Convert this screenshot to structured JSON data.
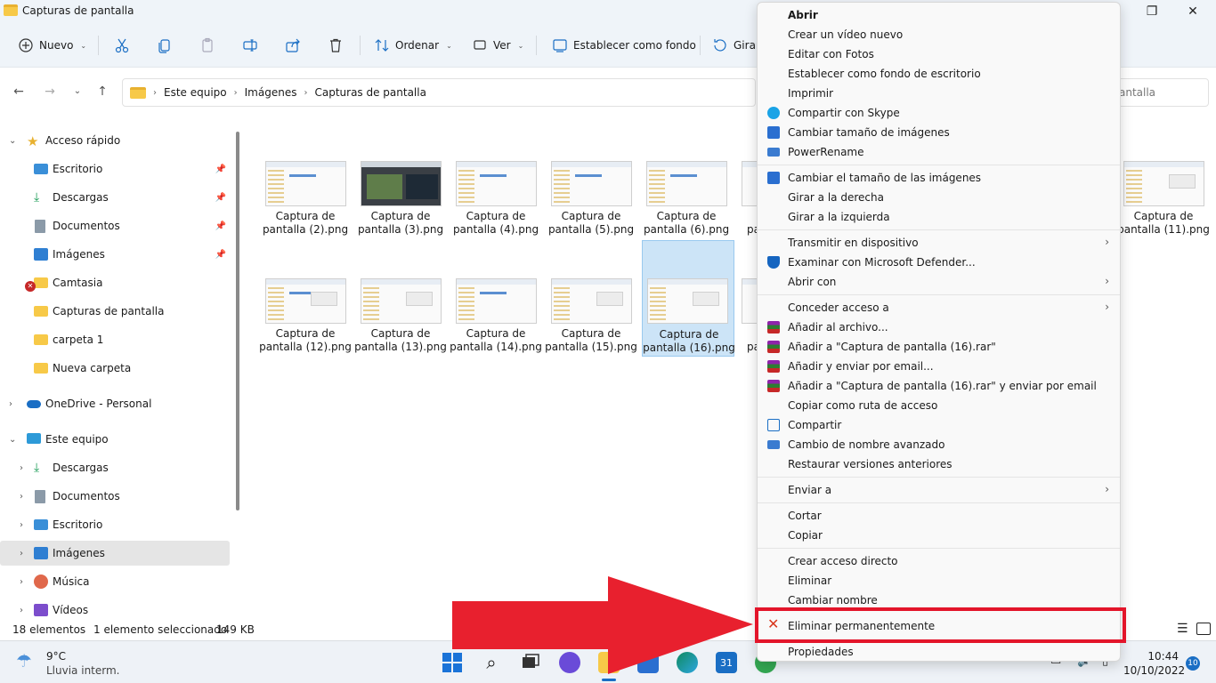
{
  "window": {
    "title": "Capturas de pantalla"
  },
  "commands": {
    "nuevo": "Nuevo",
    "ordenar": "Ordenar",
    "ver": "Ver",
    "fondo": "Establecer como fondo",
    "girar": "Girar"
  },
  "address": {
    "crumbs": [
      "Este equipo",
      "Imágenes",
      "Capturas de pantalla"
    ],
    "search_placeholder": "antalla"
  },
  "sidebar": {
    "items": [
      {
        "label": "Acceso rápido"
      },
      {
        "label": "Escritorio"
      },
      {
        "label": "Descargas"
      },
      {
        "label": "Documentos"
      },
      {
        "label": "Imágenes"
      },
      {
        "label": "Camtasia"
      },
      {
        "label": "Capturas de pantalla"
      },
      {
        "label": "carpeta 1"
      },
      {
        "label": "Nueva carpeta"
      },
      {
        "label": "OneDrive - Personal"
      },
      {
        "label": "Este equipo"
      },
      {
        "label": "Descargas"
      },
      {
        "label": "Documentos"
      },
      {
        "label": "Escritorio"
      },
      {
        "label": "Imágenes"
      },
      {
        "label": "Música"
      },
      {
        "label": "Vídeos"
      }
    ]
  },
  "files": [
    {
      "l1": "Captura de",
      "l2": "pantalla (2).png"
    },
    {
      "l1": "Captura de",
      "l2": "pantalla (3).png"
    },
    {
      "l1": "Captura de",
      "l2": "pantalla (4).png"
    },
    {
      "l1": "Captura de",
      "l2": "pantalla (5).png"
    },
    {
      "l1": "Captura de",
      "l2": "pantalla (6).png"
    },
    {
      "l1": "Captura de",
      "l2": "pantalla (11).png"
    },
    {
      "l1": "Captura de",
      "l2": "pantalla (12).png"
    },
    {
      "l1": "Captura de",
      "l2": "pantalla (13).png"
    },
    {
      "l1": "Captura de",
      "l2": "pantalla (14).png"
    },
    {
      "l1": "Captura de",
      "l2": "pantalla (15).png"
    },
    {
      "l1": "Captura de",
      "l2": "pantalla (16).png"
    },
    {
      "l1": "pa",
      "l2": ""
    },
    {
      "l1": "pa",
      "l2": ""
    }
  ],
  "status": {
    "count": "18 elementos",
    "selected": "1 elemento seleccionado",
    "size": "149 KB"
  },
  "taskbar": {
    "temp": "9°C",
    "weather": "Lluvia interm.",
    "time": "10:44",
    "date": "10/10/2022",
    "notifications": "10",
    "calendar_day": "31"
  },
  "menu": {
    "items": [
      "Abrir",
      "Crear un vídeo nuevo",
      "Editar con Fotos",
      "Establecer como fondo de escritorio",
      "Imprimir",
      "Compartir con Skype",
      "Cambiar tamaño de imágenes",
      "PowerRename",
      "Cambiar el tamaño de las imágenes",
      "Girar a la derecha",
      "Girar a la izquierda",
      "Transmitir en dispositivo",
      "Examinar con Microsoft Defender...",
      "Abrir con",
      "Conceder acceso a",
      "Añadir al archivo...",
      "Añadir a \"Captura de pantalla (16).rar\"",
      "Añadir y enviar por email...",
      "Añadir a \"Captura de pantalla (16).rar\" y enviar por email",
      "Copiar como ruta de acceso",
      "Compartir",
      "Cambio de nombre avanzado",
      "Restaurar versiones anteriores",
      "Enviar a",
      "Cortar",
      "Copiar",
      "Crear acceso directo",
      "Eliminar",
      "Cambiar nombre",
      "Eliminar permanentemente",
      "Propiedades"
    ]
  },
  "colors": {
    "accent": "#0078d4",
    "highlight": "#e3152a",
    "selection": "#cce4f7"
  }
}
